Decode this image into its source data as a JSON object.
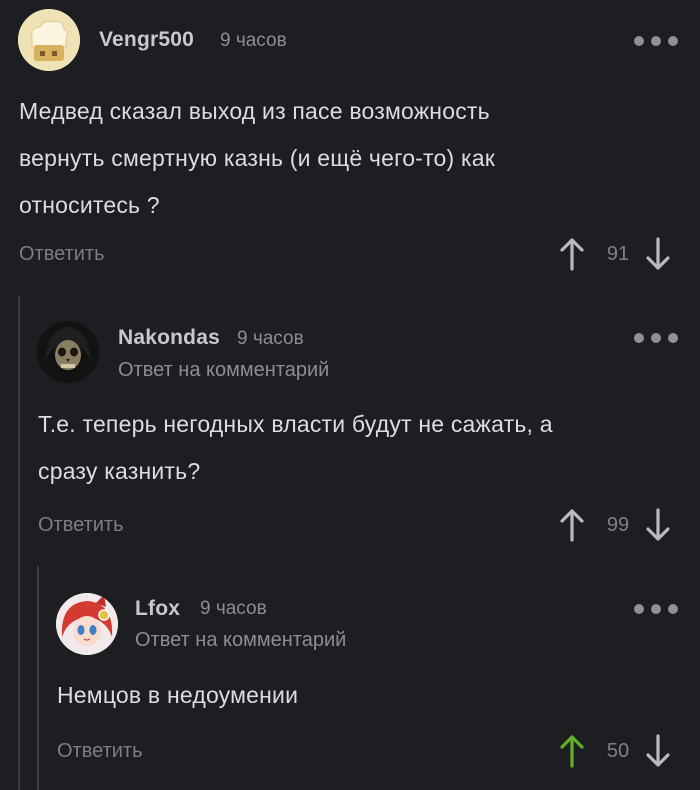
{
  "comments": [
    {
      "author": "Vengr500",
      "time": "9 часов",
      "reply_to": "",
      "text_lines": [
        "Медвед сказал выход из пасе возможность",
        "вернуть смертную казнь (и ещё чего-то) как",
        "относитесь ?"
      ],
      "reply_label": "Ответить",
      "score": "91",
      "upvoted": false,
      "avatar_icon": "chef-hat-avatar"
    },
    {
      "author": "Nakondas",
      "time": "9 часов",
      "reply_to": "Ответ на комментарий",
      "text_lines": [
        "Т.е. теперь негодных власти будут не сажать, а",
        "сразу казнить?"
      ],
      "reply_label": "Ответить",
      "score": "99",
      "upvoted": false,
      "avatar_icon": "skull-avatar"
    },
    {
      "author": "Lfox",
      "time": "9 часов",
      "reply_to": "Ответ на комментарий",
      "text_lines": [
        "Немцов в недоумении"
      ],
      "reply_label": "Ответить",
      "score": "50",
      "upvoted": true,
      "avatar_icon": "anime-girl-avatar"
    }
  ],
  "colors": {
    "background": "#1c1e21",
    "upvote_active": "#62b02a",
    "arrow_default": "#b8babd"
  }
}
